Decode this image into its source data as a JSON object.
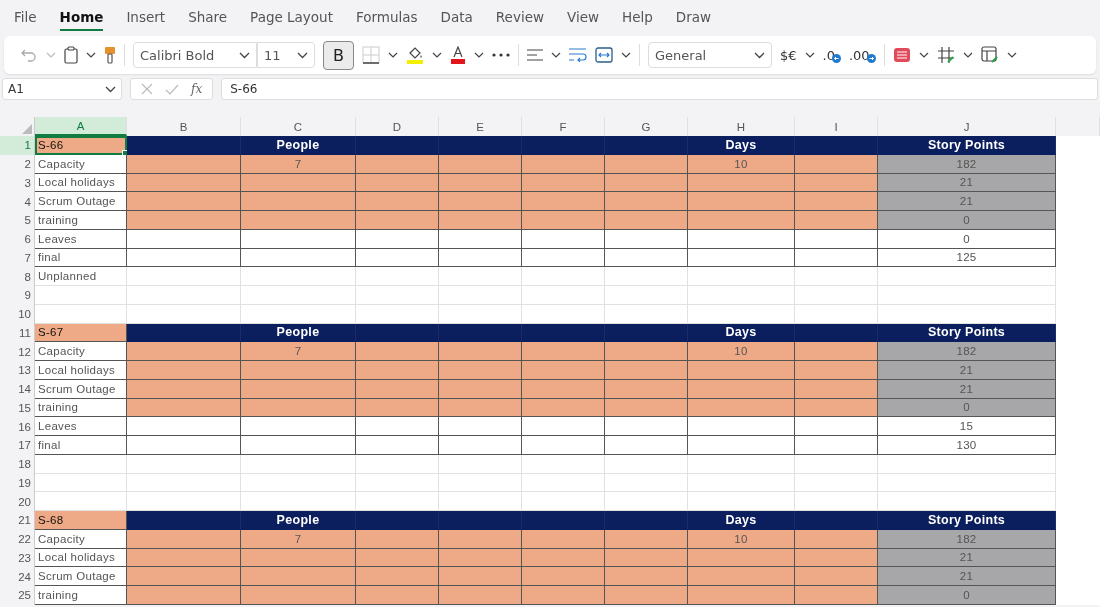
{
  "tabs": [
    {
      "label": "File",
      "selected": false
    },
    {
      "label": "Home",
      "selected": true
    },
    {
      "label": "Insert",
      "selected": false
    },
    {
      "label": "Share",
      "selected": false
    },
    {
      "label": "Page Layout",
      "selected": false
    },
    {
      "label": "Formulas",
      "selected": false
    },
    {
      "label": "Data",
      "selected": false
    },
    {
      "label": "Review",
      "selected": false
    },
    {
      "label": "View",
      "selected": false
    },
    {
      "label": "Help",
      "selected": false
    },
    {
      "label": "Draw",
      "selected": false
    }
  ],
  "toolbar": {
    "font": "Calibri Bold",
    "size": "11",
    "bold": {
      "label": "B",
      "on": true
    },
    "number_format": "General",
    "currency": "$€",
    "decrease_decimal": ".0",
    "increase_decimal": ".00"
  },
  "formula_bar": {
    "name_box": "A1",
    "fx": "fx",
    "value": "S-66"
  },
  "columns": [
    {
      "label": "A",
      "selected": true
    },
    {
      "label": "B",
      "selected": false
    },
    {
      "label": "C",
      "selected": false
    },
    {
      "label": "D",
      "selected": false
    },
    {
      "label": "E",
      "selected": false
    },
    {
      "label": "F",
      "selected": false
    },
    {
      "label": "G",
      "selected": false
    },
    {
      "label": "H",
      "selected": false
    },
    {
      "label": "I",
      "selected": false
    },
    {
      "label": "J",
      "selected": false
    }
  ],
  "rows": [
    {
      "num": "1",
      "kind": "header",
      "selected": true,
      "a": "S-66",
      "c": "People",
      "h": "Days",
      "j": "Story Points"
    },
    {
      "num": "2",
      "kind": "shaded",
      "selected": false,
      "a": "Capacity",
      "c": "7",
      "h": "10",
      "j": "182"
    },
    {
      "num": "3",
      "kind": "shaded",
      "selected": false,
      "a": "Local holidays",
      "j": "21"
    },
    {
      "num": "4",
      "kind": "shaded",
      "selected": false,
      "a": "Scrum Outage",
      "j": "21"
    },
    {
      "num": "5",
      "kind": "shaded",
      "selected": false,
      "a": "training",
      "j": "0"
    },
    {
      "num": "6",
      "kind": "bordered",
      "selected": false,
      "a": "Leaves",
      "j": "0"
    },
    {
      "num": "7",
      "kind": "bordered",
      "selected": false,
      "a": "final",
      "j": "125"
    },
    {
      "num": "8",
      "kind": "plain",
      "selected": false,
      "a": "Unplanned"
    },
    {
      "num": "9",
      "kind": "plain",
      "selected": false
    },
    {
      "num": "10",
      "kind": "plain",
      "selected": false
    },
    {
      "num": "11",
      "kind": "header",
      "selected": false,
      "a": "S-67",
      "c": "People",
      "h": "Days",
      "j": "Story Points"
    },
    {
      "num": "12",
      "kind": "shaded",
      "selected": false,
      "a": "Capacity",
      "c": "7",
      "h": "10",
      "j": "182"
    },
    {
      "num": "13",
      "kind": "shaded",
      "selected": false,
      "a": "Local holidays",
      "j": "21"
    },
    {
      "num": "14",
      "kind": "shaded",
      "selected": false,
      "a": "Scrum Outage",
      "j": "21"
    },
    {
      "num": "15",
      "kind": "shaded",
      "selected": false,
      "a": "training",
      "j": "0"
    },
    {
      "num": "16",
      "kind": "bordered",
      "selected": false,
      "a": "Leaves",
      "j": "15"
    },
    {
      "num": "17",
      "kind": "bordered",
      "selected": false,
      "a": "final",
      "j": "130"
    },
    {
      "num": "18",
      "kind": "plain",
      "selected": false
    },
    {
      "num": "19",
      "kind": "plain",
      "selected": false
    },
    {
      "num": "20",
      "kind": "plain",
      "selected": false
    },
    {
      "num": "21",
      "kind": "header",
      "selected": false,
      "a": "S-68",
      "c": "People",
      "h": "Days",
      "j": "Story Points"
    },
    {
      "num": "22",
      "kind": "shaded",
      "selected": false,
      "a": "Capacity",
      "c": "7",
      "h": "10",
      "j": "182"
    },
    {
      "num": "23",
      "kind": "shaded",
      "selected": false,
      "a": "Local holidays",
      "j": "21"
    },
    {
      "num": "24",
      "kind": "shaded",
      "selected": false,
      "a": "Scrum Outage",
      "j": "21"
    },
    {
      "num": "25",
      "kind": "shaded",
      "selected": false,
      "a": "training",
      "j": "0"
    }
  ]
}
